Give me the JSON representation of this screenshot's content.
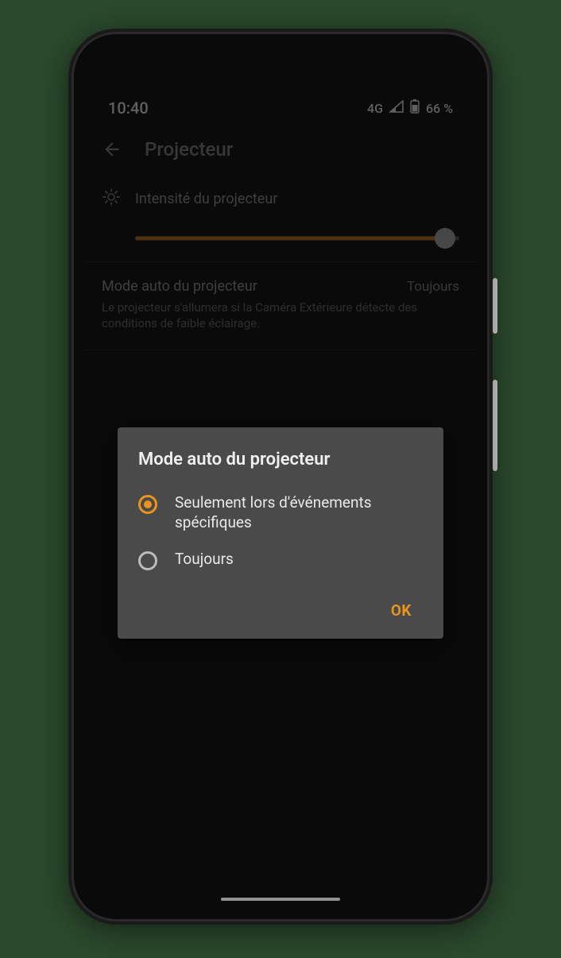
{
  "status": {
    "time": "10:40",
    "network": "4G",
    "battery": "66 %"
  },
  "header": {
    "title": "Projecteur"
  },
  "intensity": {
    "label": "Intensité du projecteur"
  },
  "mode": {
    "label": "Mode auto du projecteur",
    "value": "Toujours",
    "description": "Le projecteur s'allumera si la Caméra Extérieure détecte des conditions de faible éclairage."
  },
  "dialog": {
    "title": "Mode auto du projecteur",
    "options": [
      {
        "label": "Seulement lors d'événements spécifiques",
        "selected": true
      },
      {
        "label": "Toujours",
        "selected": false
      }
    ],
    "ok": "OK"
  },
  "colors": {
    "accent": "#e8941f",
    "dialogBg": "#4a4a4a",
    "pageBg": "#2b4a2d"
  }
}
